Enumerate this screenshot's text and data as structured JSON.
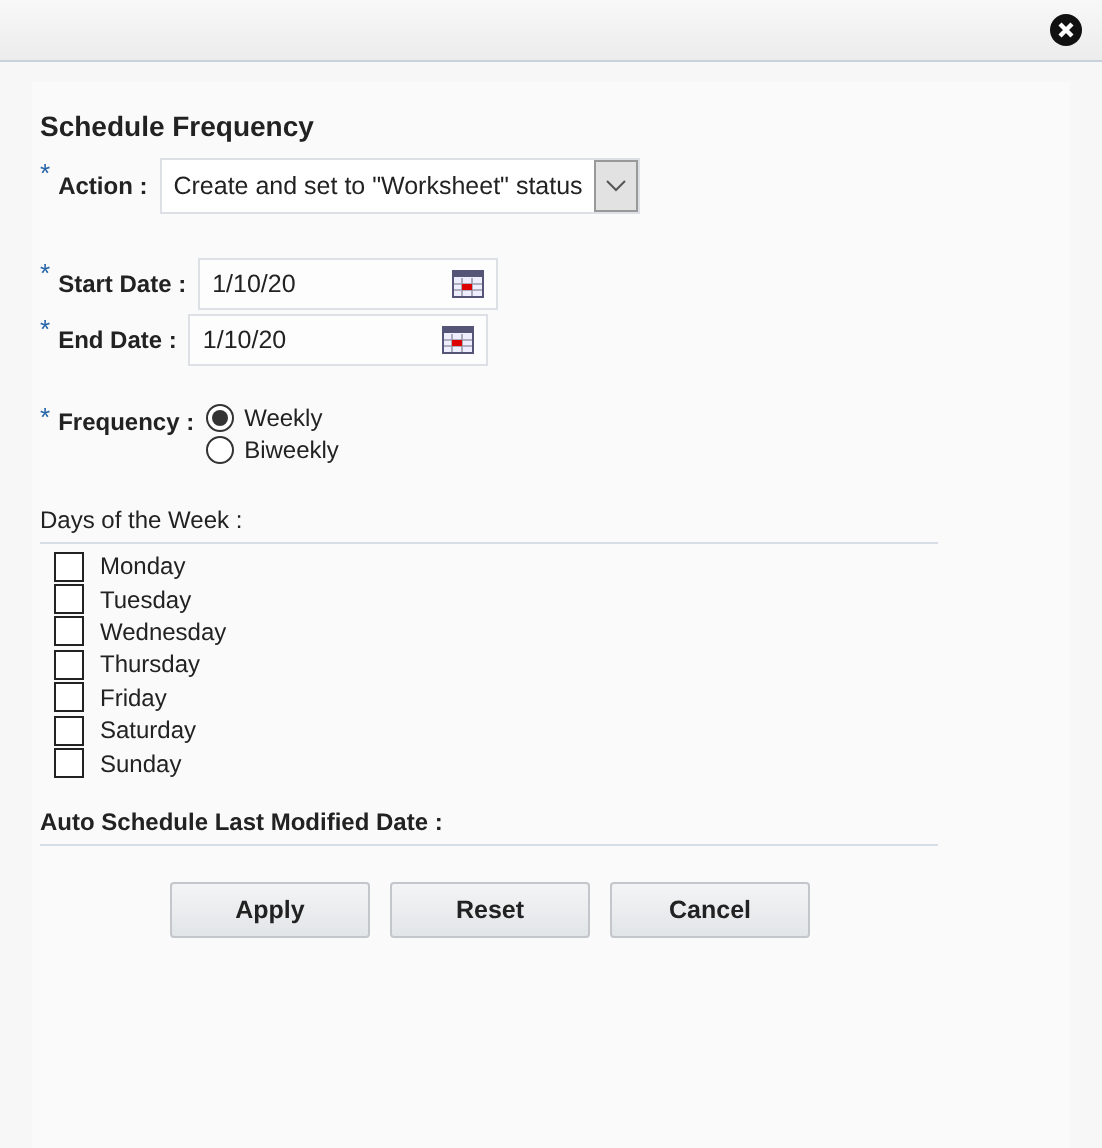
{
  "title": "Schedule Frequency",
  "action": {
    "label": "Action :",
    "required_mark": "*",
    "value": "Create and set to \"Worksheet\" status"
  },
  "start_date": {
    "label": "Start Date :",
    "required_mark": "*",
    "value": "1/10/20"
  },
  "end_date": {
    "label": "End Date :",
    "required_mark": "*",
    "value": "1/10/20"
  },
  "frequency": {
    "label": "Frequency :",
    "required_mark": "*",
    "options": [
      {
        "label": "Weekly",
        "selected": true
      },
      {
        "label": "Biweekly",
        "selected": false
      }
    ]
  },
  "days_label": "Days of the Week :",
  "days": [
    {
      "label": "Monday",
      "checked": false
    },
    {
      "label": "Tuesday",
      "checked": false
    },
    {
      "label": "Wednesday",
      "checked": false
    },
    {
      "label": "Thursday",
      "checked": false
    },
    {
      "label": "Friday",
      "checked": false
    },
    {
      "label": "Saturday",
      "checked": false
    },
    {
      "label": "Sunday",
      "checked": false
    }
  ],
  "last_modified_label": "Auto Schedule Last Modified Date :",
  "buttons": [
    "Apply",
    "Reset",
    "Cancel"
  ]
}
